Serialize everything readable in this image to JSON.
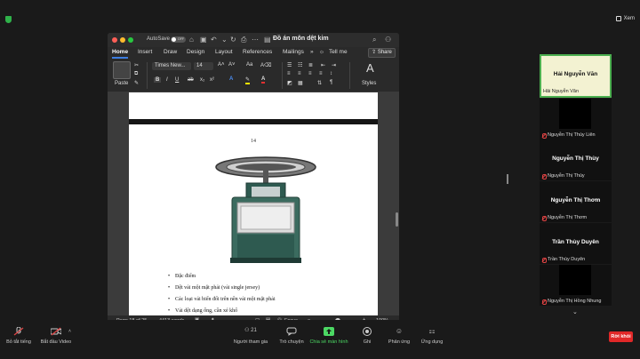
{
  "top_bar": {
    "view_label": "Xem"
  },
  "word": {
    "autosave_label": "AutoSave",
    "autosave_state": "OFF",
    "document_title": "Đồ án môn dệt kim",
    "tabs": [
      "Home",
      "Insert",
      "Draw",
      "Design",
      "Layout",
      "References",
      "Mailings",
      "Tell me"
    ],
    "share_label": "Share",
    "ribbon": {
      "paste_label": "Paste",
      "font_name": "Times New...",
      "font_size": "14",
      "styles_label": "Styles"
    },
    "page": {
      "number": "14",
      "bullets": [
        "Đặc điểm",
        "Dệt vải một mặt phải (vải single jersey)",
        "Các loại vải biến đổi trên nền vải một mặt phải",
        "Vải dệt dạng ống, cần xé khổ"
      ]
    },
    "status": {
      "page_info": "Page 18 of 25",
      "word_count": "4413 words",
      "focus_label": "Focus",
      "zoom": "100%"
    }
  },
  "participants": [
    {
      "display": "Hải Nguyễn Văn",
      "label": "Hải Nguyễn Văn",
      "muted": false,
      "camera": false
    },
    {
      "display": "",
      "label": "Nguyễn Thị Thúy Liên",
      "muted": true,
      "camera": true
    },
    {
      "display": "Nguyễn Thị Thùy",
      "label": "Nguyễn Thị Thùy",
      "muted": true,
      "camera": false
    },
    {
      "display": "Nguyễn Thị Thơm",
      "label": "Nguyễn Thị Thơm",
      "muted": true,
      "camera": false
    },
    {
      "display": "Trần Thùy Duyên",
      "label": "Trần Thùy Duyên",
      "muted": true,
      "camera": false
    },
    {
      "display": "",
      "label": "Nguyễn Thị Hồng Nhung",
      "muted": true,
      "camera": true
    }
  ],
  "toolbar": {
    "unmute": "Bỏ tắt tiếng",
    "start_video": "Bắt đầu Video",
    "participants": "Người tham gia",
    "participants_count": "21",
    "chat": "Trò chuyện",
    "share_screen": "Chia sẻ màn hình",
    "record": "Ghi",
    "reactions": "Phản ứng",
    "apps": "Ứng dụng",
    "leave": "Rời khỏi"
  },
  "colors": {
    "accent_blue": "#3d7de0",
    "share_green": "#4cd964",
    "leave_red": "#e02828",
    "active_speaker_border": "#4caf50"
  }
}
